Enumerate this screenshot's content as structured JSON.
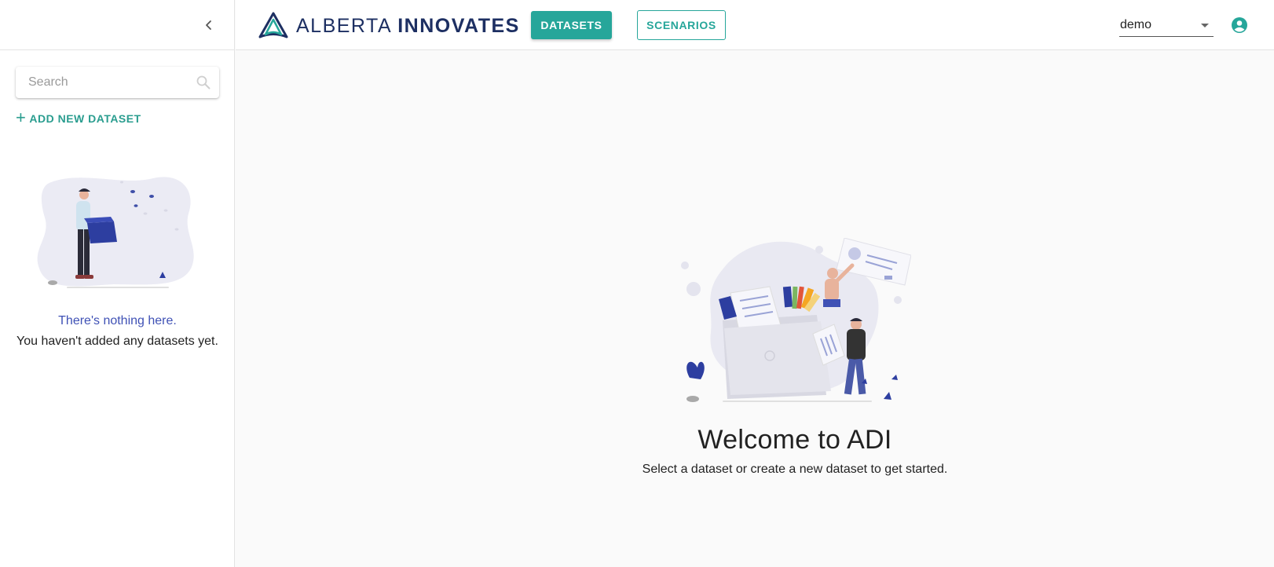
{
  "brand": {
    "name_light": "ALBERTA",
    "name_bold": "INNOVATES",
    "primary_color": "#26a69a",
    "navy_color": "#1d2f62"
  },
  "header": {
    "nav": {
      "datasets_label": "DATASETS",
      "scenarios_label": "SCENARIOS",
      "active": "DATASETS"
    },
    "user_select": {
      "value": "demo"
    },
    "icons": {
      "account": "account-circle-icon",
      "caret": "caret-down-icon"
    }
  },
  "sidebar": {
    "search": {
      "placeholder": "Search",
      "value": ""
    },
    "add_dataset_label": "ADD NEW DATASET",
    "empty_state": {
      "title": "There's nothing here.",
      "message": "You haven't added any datasets yet."
    },
    "icons": {
      "collapse": "chevron-left-icon",
      "search": "search-icon",
      "add": "plus-icon"
    }
  },
  "main": {
    "welcome_title": "Welcome to ADI",
    "welcome_message": "Select a dataset or create a new dataset to get started."
  }
}
